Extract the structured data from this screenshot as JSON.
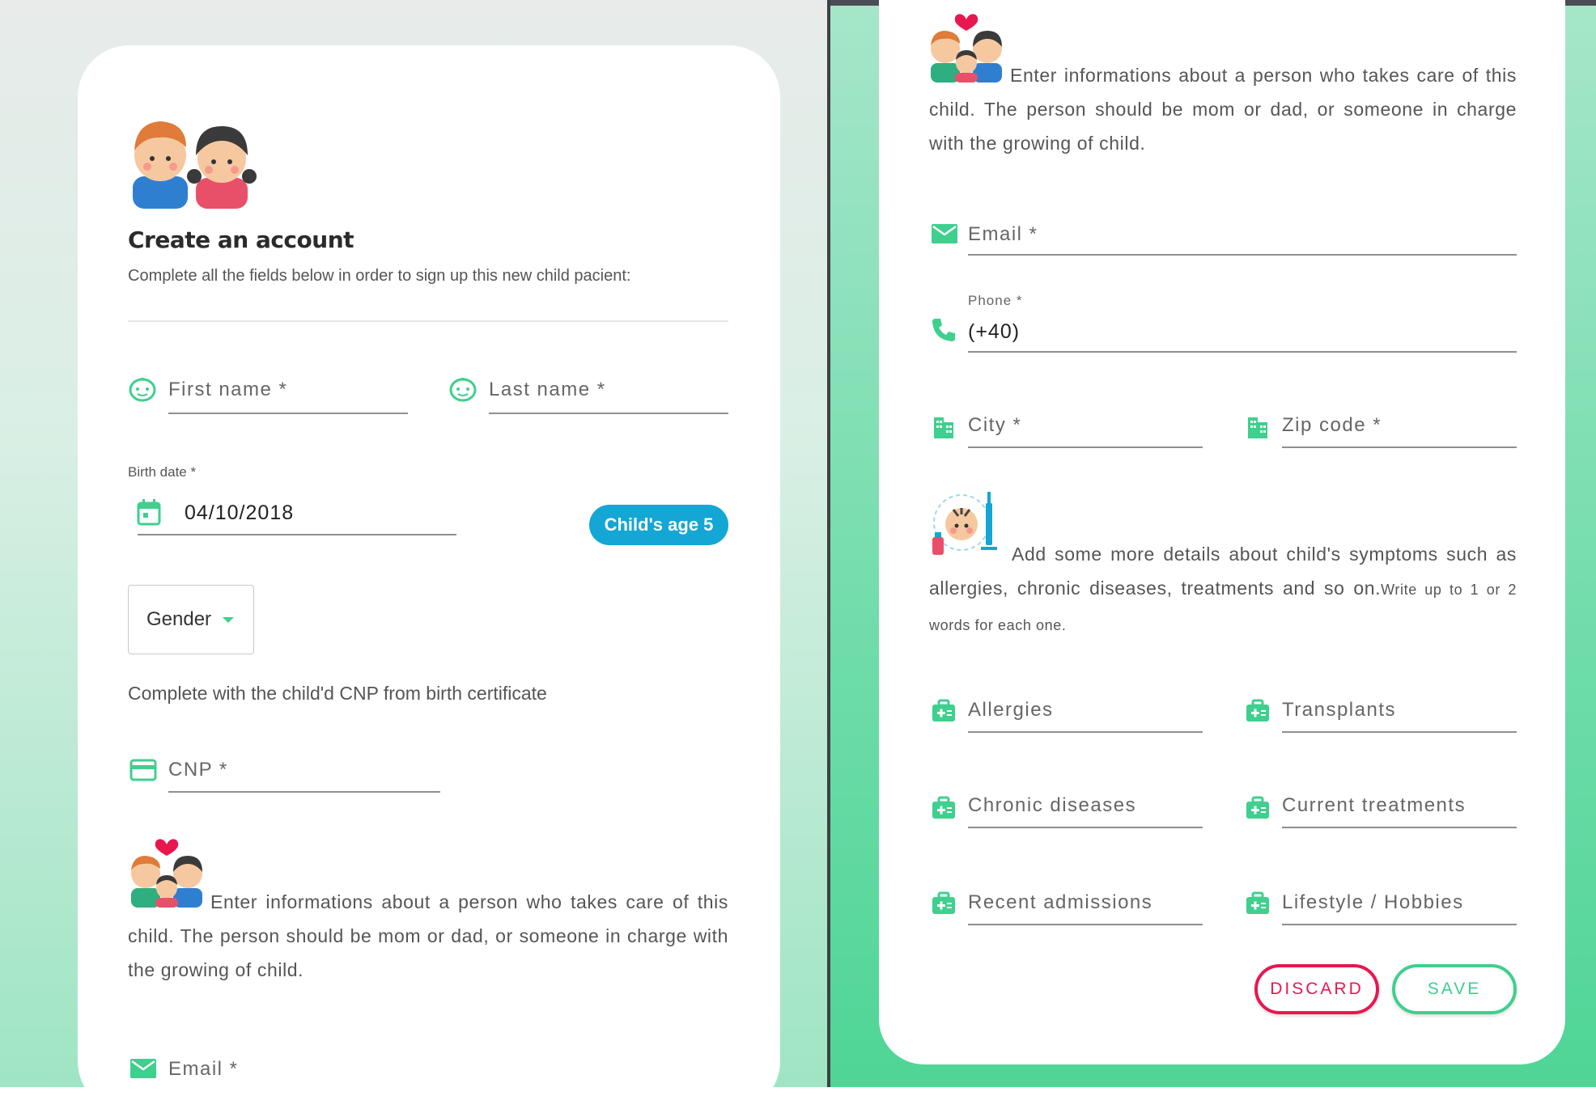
{
  "colors": {
    "accent": "#3fcf8e",
    "age_button": "#14a6d4",
    "discard": "#e8174f"
  },
  "left": {
    "title": "Create an account",
    "subtitle": "Complete all the fields below in order to sign up this new child pacient:",
    "first_name": "First name *",
    "last_name": "Last name *",
    "birth_date_label": "Birth date *",
    "birth_date_value": "04/10/2018",
    "age_button": "Child's age 5",
    "gender_label": "Gender",
    "cnp_hint": "Complete with the child'd CNP from birth certificate",
    "cnp": "CNP *",
    "caregiver_text": "Enter informations about a person who takes care of this child. The person should be mom or dad, or someone in charge with the growing of child.",
    "email": "Email *"
  },
  "right": {
    "caregiver_text": "Enter informations about a person who takes care of this child. The person should be mom or dad, or someone in charge with the growing of child.",
    "email": "Email *",
    "phone_label": "Phone *",
    "phone_value": "(+40)",
    "city": "City *",
    "zip": "Zip code *",
    "symptoms_text": "Add some more details about child's symptoms such as allergies, chronic diseases, treatments and so on.",
    "symptoms_small": "Write up to 1 or 2 words for each one.",
    "allergies": "Allergies",
    "transplants": "Transplants",
    "chronic": "Chronic diseases",
    "treatments": "Current treatments",
    "admissions": "Recent admissions",
    "lifestyle": "Lifestyle / Hobbies",
    "discard": "DISCARD",
    "save": "SAVE"
  },
  "icons": [
    "children-illustration",
    "face-icon",
    "calendar-icon",
    "card-icon",
    "family-illustration",
    "mail-icon",
    "phone-icon",
    "building-icon",
    "doctor-baby-illustration",
    "medical-kit-icon"
  ]
}
